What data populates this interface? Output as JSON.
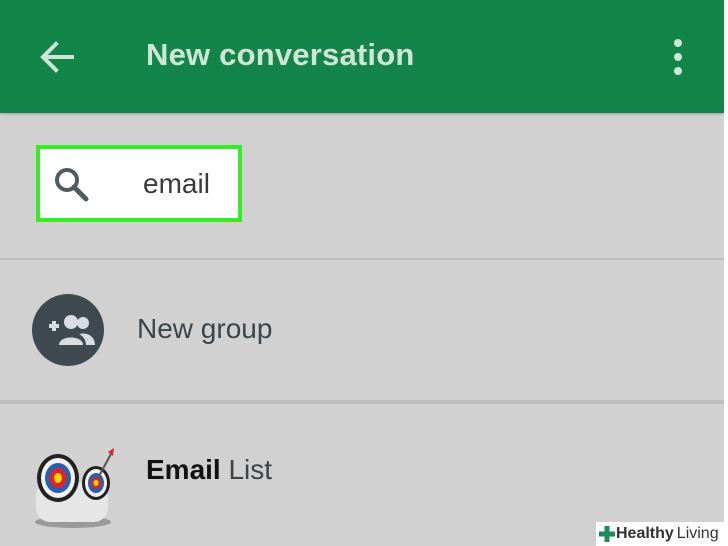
{
  "colors": {
    "app_bar": "#138548",
    "background": "#d1d1d1",
    "highlight": "#33ee22",
    "avatar_dark": "#3e4a50"
  },
  "app_bar": {
    "title": "New conversation",
    "back_icon": "arrow-left-icon",
    "menu_icon": "more-vert-icon"
  },
  "search": {
    "value": "email",
    "icon": "search-icon"
  },
  "new_group": {
    "label": "New group",
    "icon": "group-add-icon"
  },
  "contact": {
    "name_bold": "Email",
    "name_rest": "List",
    "avatar": "target-dartboard-image"
  },
  "watermark": {
    "brand": "Healthy",
    "brand_rest": "Living"
  }
}
